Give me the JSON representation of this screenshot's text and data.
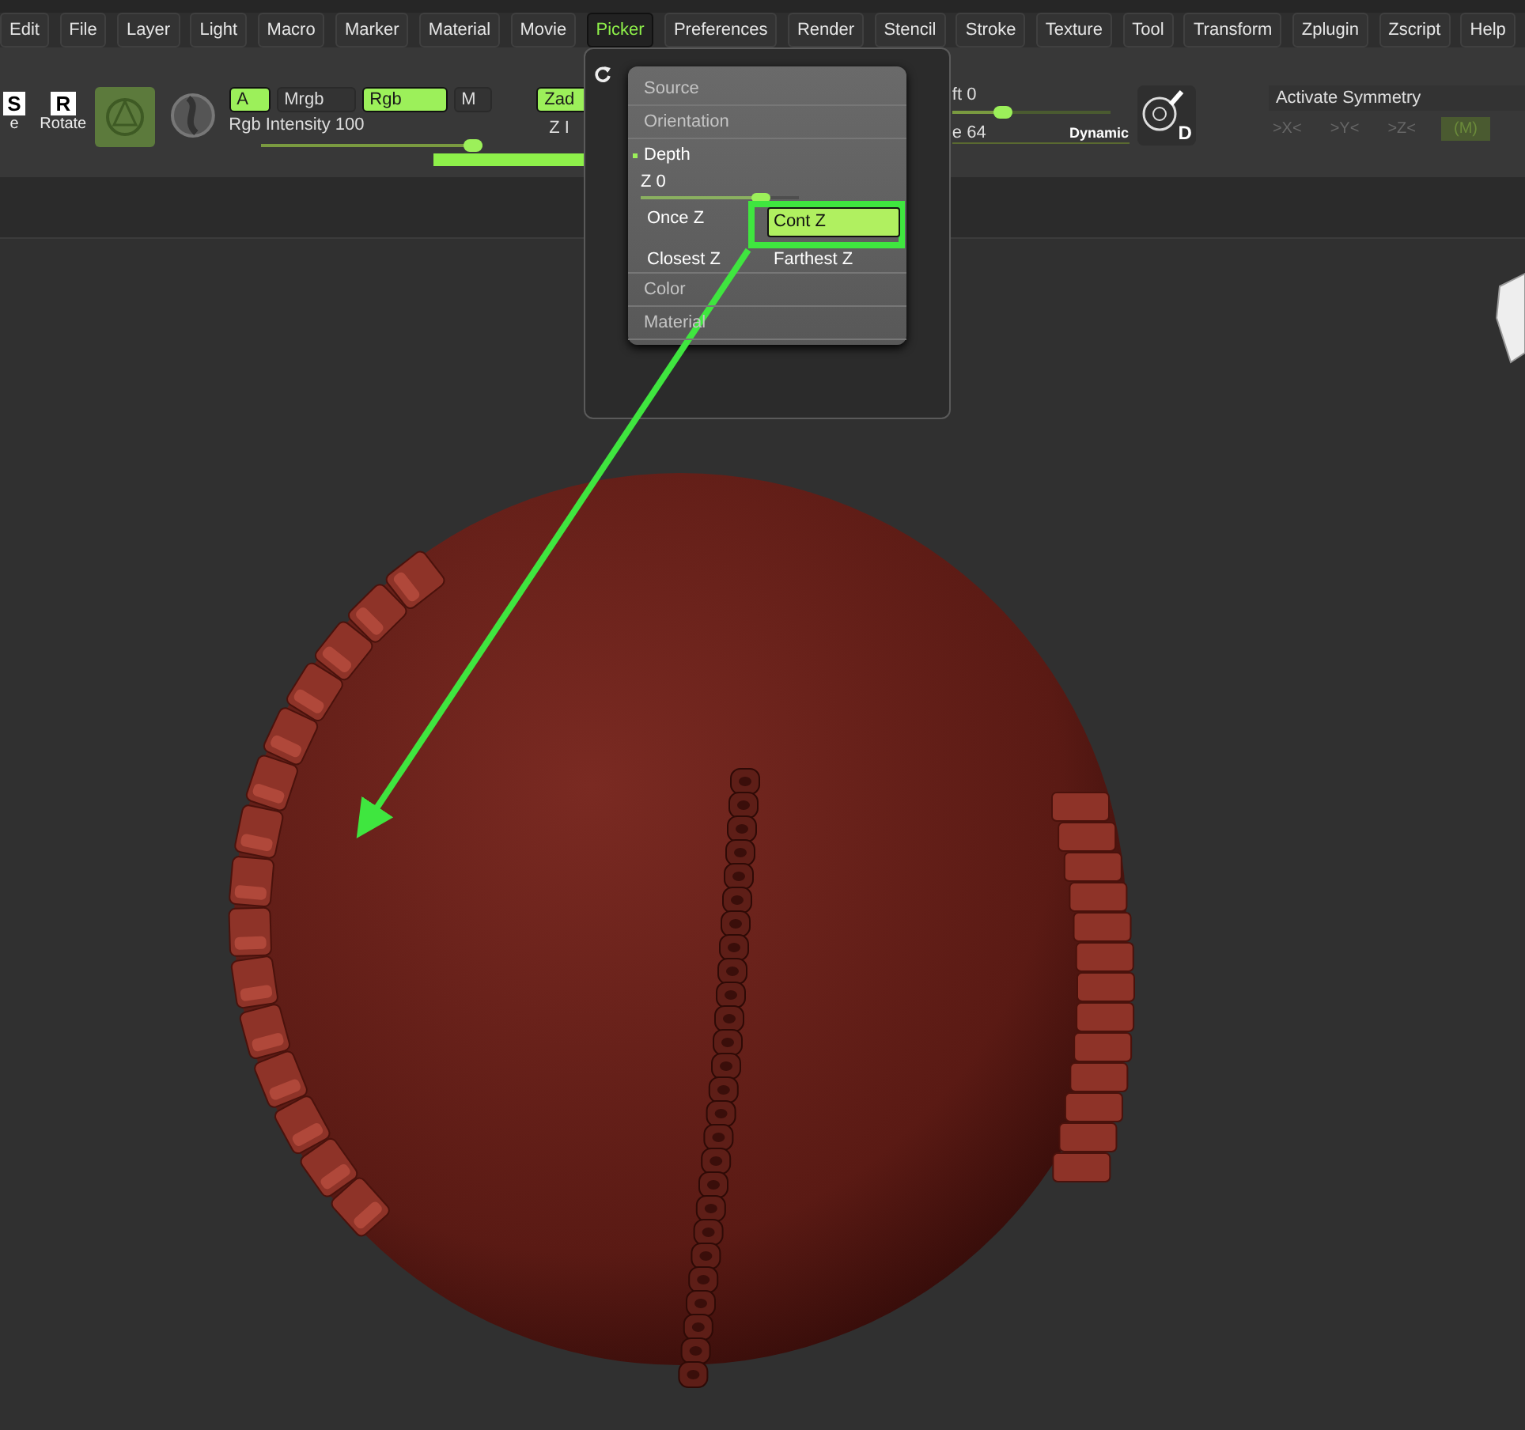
{
  "menu": [
    {
      "label": "Edit",
      "selected": false
    },
    {
      "label": "File",
      "selected": false
    },
    {
      "label": "Layer",
      "selected": false
    },
    {
      "label": "Light",
      "selected": false
    },
    {
      "label": "Macro",
      "selected": false
    },
    {
      "label": "Marker",
      "selected": false
    },
    {
      "label": "Material",
      "selected": false
    },
    {
      "label": "Movie",
      "selected": false
    },
    {
      "label": "Picker",
      "selected": true
    },
    {
      "label": "Preferences",
      "selected": false
    },
    {
      "label": "Render",
      "selected": false
    },
    {
      "label": "Stencil",
      "selected": false
    },
    {
      "label": "Stroke",
      "selected": false
    },
    {
      "label": "Texture",
      "selected": false
    },
    {
      "label": "Tool",
      "selected": false
    },
    {
      "label": "Transform",
      "selected": false
    },
    {
      "label": "Zplugin",
      "selected": false
    },
    {
      "label": "Zscript",
      "selected": false
    },
    {
      "label": "Help",
      "selected": false
    }
  ],
  "tools": [
    {
      "key": "S",
      "label": "e"
    },
    {
      "key": "R",
      "label": "Rotate"
    }
  ],
  "color_modes": [
    {
      "label": "A",
      "selected": true
    },
    {
      "label": "Mrgb",
      "selected": false
    },
    {
      "label": "Rgb",
      "selected": true
    },
    {
      "label": "M",
      "selected": false
    }
  ],
  "rgb_intensity": {
    "label": "Rgb Intensity 100",
    "level": 1.0
  },
  "zadd": {
    "label": "Zad",
    "selected": true
  },
  "z_intensity": {
    "label": "Z I"
  },
  "focal": {
    "label": "ft 0",
    "level": 0.3
  },
  "draw_size": {
    "label": "e 64",
    "dynamic": "Dynamic"
  },
  "lightbox": {
    "key": "D"
  },
  "symmetry": {
    "label": "Activate Symmetry",
    "axes": [
      {
        "label": ">X<",
        "on": false
      },
      {
        "label": ">Y<",
        "on": false
      },
      {
        "label": ">Z<",
        "on": false
      },
      {
        "label": "(M)",
        "on": true
      }
    ]
  },
  "popup": {
    "sections": [
      {
        "label": "Source",
        "expanded": false
      },
      {
        "label": "Orientation",
        "expanded": false
      },
      {
        "label": "Depth",
        "expanded": true,
        "slider": {
          "label": "Z 0",
          "level": 0.8
        },
        "options": [
          {
            "label": "Once Z",
            "selected": false
          },
          {
            "label": "Cont Z",
            "selected": true
          },
          {
            "label": "Closest Z",
            "selected": false
          },
          {
            "label": "Farthest Z",
            "selected": false
          }
        ]
      },
      {
        "label": "Color",
        "expanded": false
      },
      {
        "label": "Material",
        "expanded": false
      }
    ]
  }
}
